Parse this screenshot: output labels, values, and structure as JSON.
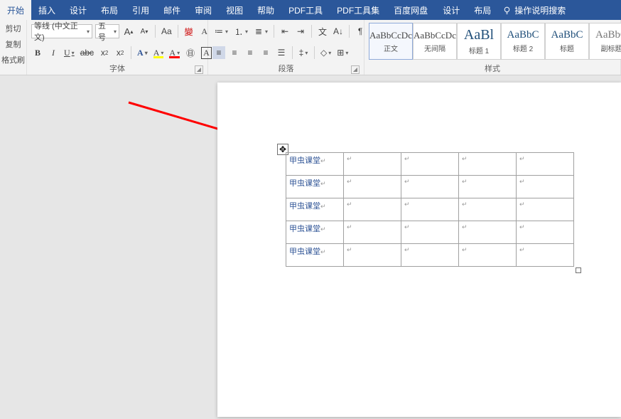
{
  "tabs": {
    "start": "开始",
    "insert": "插入",
    "design": "设计",
    "layout": "布局",
    "references": "引用",
    "mailings": "邮件",
    "review": "审阅",
    "view": "视图",
    "help": "帮助",
    "pdf_tool": "PDF工具",
    "pdf_toolset": "PDF工具集",
    "baidu_pan": "百度网盘",
    "design2": "设计",
    "layout2": "布局",
    "tellme": "操作说明搜索"
  },
  "clipboard": {
    "cut": "剪切",
    "copy": "复制",
    "format_painter": "格式刷"
  },
  "font": {
    "family": "等线 (中文正文)",
    "size": "五号",
    "grow": "A",
    "shrink": "A",
    "change_case": "Aa",
    "clear": "A",
    "bold": "B",
    "italic": "I",
    "underline": "U",
    "strike": "abc",
    "sub": "x",
    "sup": "x",
    "text_effects": "A",
    "highlight": "A",
    "font_color": "A",
    "group_label": "字体"
  },
  "para": {
    "group_label": "段落"
  },
  "styles": {
    "group_label": "样式",
    "items": [
      {
        "preview": "AaBbCcDc",
        "name": "正文",
        "class": ""
      },
      {
        "preview": "AaBbCcDc",
        "name": "无间隔",
        "class": ""
      },
      {
        "preview": "AaBl",
        "name": "标题 1",
        "class": "big blue"
      },
      {
        "preview": "AaBbC",
        "name": "标题 2",
        "class": "blue"
      },
      {
        "preview": "AaBbC",
        "name": "标题",
        "class": "blue"
      },
      {
        "preview": "AaBbC",
        "name": "副标题",
        "class": ""
      }
    ]
  },
  "doc": {
    "cell_text": "甲虫课堂",
    "rows": 5,
    "cols": 5
  }
}
